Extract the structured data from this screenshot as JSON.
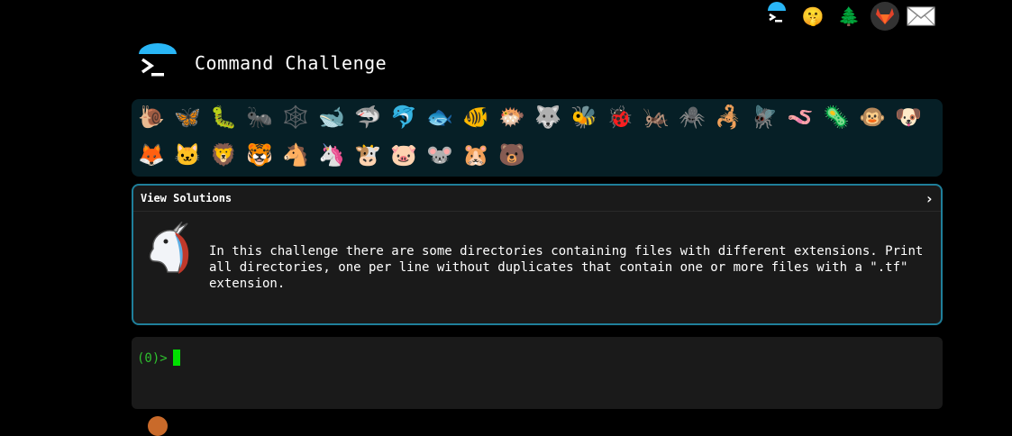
{
  "header": {
    "title": "Command Challenge"
  },
  "top_icons": [
    "terminal-icon",
    "shush-face-icon",
    "tree-icon",
    "gitlab-icon",
    "mail-icon"
  ],
  "animals_row1": [
    "🐌",
    "🦋",
    "🐛",
    "🐜",
    "🕸️",
    "🐋",
    "🦈",
    "🐬",
    "🐟",
    "🐠",
    "🐡",
    "🐺",
    "🐝",
    "🐞",
    "🦗",
    "🕷️",
    "🦂",
    "🪰",
    "🪱",
    "🦠",
    "🐵",
    "🐶"
  ],
  "animals_row2": [
    "🦊",
    "🐱",
    "🦁",
    "🐯",
    "🐴",
    "🦄",
    "🐮",
    "🐷",
    "🐭",
    "🐹",
    "🐻"
  ],
  "solutions": {
    "label": "View Solutions",
    "chevron": "›",
    "description": "In this challenge there are some directories containing files with different extensions. Print all directories, one per line without duplicates that contain one or more files with a \".tf\" extension."
  },
  "terminal": {
    "prompt": "(0)>"
  },
  "colors": {
    "accent": "#1f7f9a",
    "prompt_green": "#2ec22e"
  }
}
